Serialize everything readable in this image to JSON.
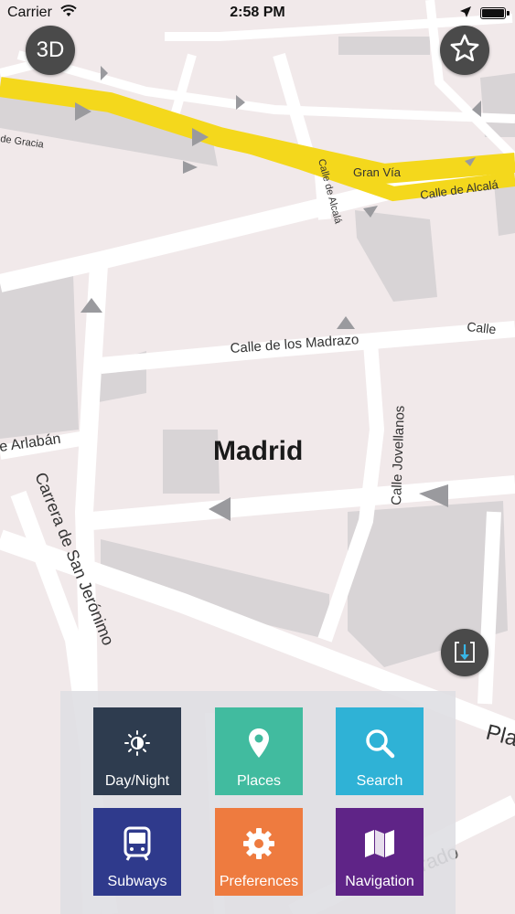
{
  "status_bar": {
    "carrier": "Carrier",
    "time": "2:58 PM"
  },
  "map": {
    "city_label": "Madrid",
    "street_labels": {
      "gran_via": "Gran Vía",
      "calle_de_alcala_main": "Calle de Alcalá",
      "calle_de_alcala_side": "Calle de Alcalá",
      "de_gracia": "de Gracia",
      "calle_de_los_madrazo": "Calle de los Madrazo",
      "calle_right": "Calle",
      "de_arlaban": "e Arlabán",
      "calle_jovellanos": "Calle Jovellanos",
      "carrera_de_san_jeronimo": "Carrera de San Jerónimo",
      "pla": "Pla",
      "rado": "rado"
    }
  },
  "buttons": {
    "three_d_label": "3D"
  },
  "menu": {
    "tiles": [
      {
        "label": "Day/Night",
        "icon": "day-night-icon",
        "color": "#2e3c4f"
      },
      {
        "label": "Places",
        "icon": "map-pin-icon",
        "color": "#41bb9f"
      },
      {
        "label": "Search",
        "icon": "search-icon",
        "color": "#2fb2d6"
      },
      {
        "label": "Subways",
        "icon": "subway-icon",
        "color": "#2f3a8c"
      },
      {
        "label": "Preferences",
        "icon": "gear-icon",
        "color": "#ee7b3f"
      },
      {
        "label": "Navigation",
        "icon": "map-icon",
        "color": "#5f2487"
      }
    ]
  }
}
